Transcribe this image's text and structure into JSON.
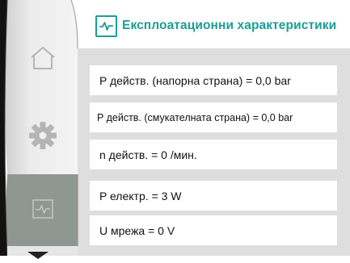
{
  "nav": {
    "items": [
      {
        "icon": "home-icon",
        "state": "inactive"
      },
      {
        "icon": "gear-icon",
        "state": "inactive"
      },
      {
        "icon": "performance-icon",
        "state": "selected"
      }
    ],
    "more_indicator": "chevron-down-icon"
  },
  "header": {
    "title": "Експлоатационни характеристики",
    "icon": "performance-icon"
  },
  "values": [
    {
      "label": "P действ. (напорна страна) = 0,0 bar"
    },
    {
      "label": "P действ. (смукателната страна) = 0,0 bar"
    },
    {
      "label": "n действ. = 0 /мин."
    },
    {
      "label": "P електр. = 3 W"
    },
    {
      "label": "U мрежа = 0 V"
    }
  ],
  "colors": {
    "accent": "#1a9e95",
    "panel_bg": "#dedede",
    "rail_selected": "#8f9792",
    "rail_bg": "#e8e8e8"
  }
}
